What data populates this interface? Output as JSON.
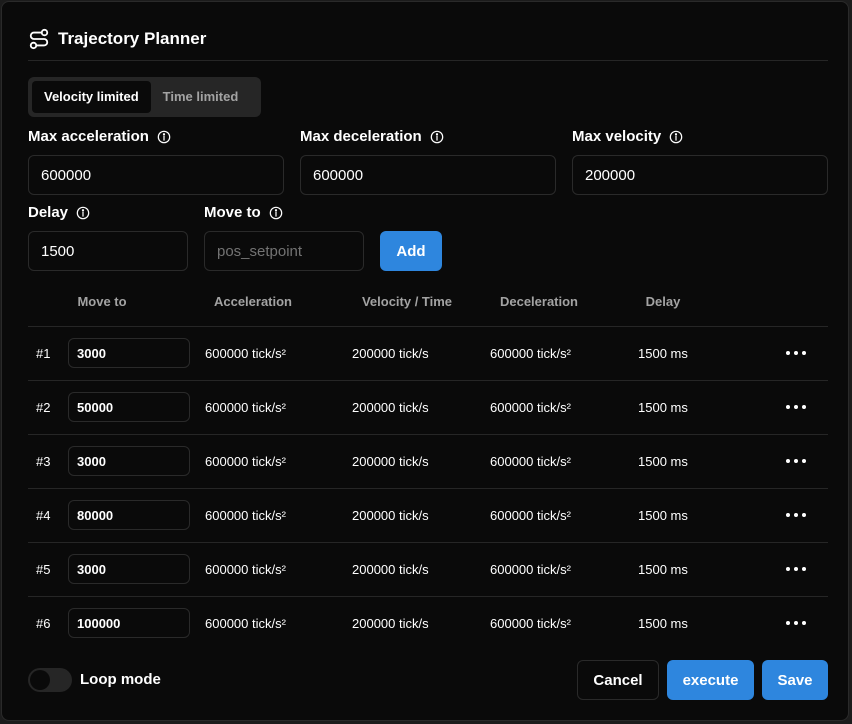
{
  "dialog": {
    "title": "Trajectory Planner",
    "icon": "route-icon"
  },
  "mode_tabs": [
    {
      "label": "Velocity limited",
      "active": true
    },
    {
      "label": "Time limited",
      "active": false
    }
  ],
  "fields": {
    "max_acceleration": {
      "label": "Max acceleration",
      "value": "600000"
    },
    "max_deceleration": {
      "label": "Max deceleration",
      "value": "600000"
    },
    "max_velocity": {
      "label": "Max velocity",
      "value": "200000"
    },
    "delay": {
      "label": "Delay",
      "value": "1500"
    },
    "move_to": {
      "label": "Move to",
      "value": "",
      "placeholder": "pos_setpoint"
    }
  },
  "add_button": "Add",
  "table": {
    "headers": [
      "Move to",
      "Acceleration",
      "Velocity / Time",
      "Deceleration",
      "Delay"
    ],
    "rows": [
      {
        "index": "#1",
        "move_to": "3000",
        "acceleration": "600000 tick/s²",
        "velocity": "200000 tick/s",
        "deceleration": "600000 tick/s²",
        "delay": "1500 ms"
      },
      {
        "index": "#2",
        "move_to": "50000",
        "acceleration": "600000 tick/s²",
        "velocity": "200000 tick/s",
        "deceleration": "600000 tick/s²",
        "delay": "1500 ms"
      },
      {
        "index": "#3",
        "move_to": "3000",
        "acceleration": "600000 tick/s²",
        "velocity": "200000 tick/s",
        "deceleration": "600000 tick/s²",
        "delay": "1500 ms"
      },
      {
        "index": "#4",
        "move_to": "80000",
        "acceleration": "600000 tick/s²",
        "velocity": "200000 tick/s",
        "deceleration": "600000 tick/s²",
        "delay": "1500 ms"
      },
      {
        "index": "#5",
        "move_to": "3000",
        "acceleration": "600000 tick/s²",
        "velocity": "200000 tick/s",
        "deceleration": "600000 tick/s²",
        "delay": "1500 ms"
      },
      {
        "index": "#6",
        "move_to": "100000",
        "acceleration": "600000 tick/s²",
        "velocity": "200000 tick/s",
        "deceleration": "600000 tick/s²",
        "delay": "1500 ms"
      }
    ]
  },
  "footer": {
    "loop_mode_label": "Loop mode",
    "loop_mode_on": false,
    "cancel_label": "Cancel",
    "execute_label": "execute",
    "save_label": "Save"
  },
  "colors": {
    "background": "#0a0a0a",
    "accent": "#2e86de",
    "border": "#2a2a2a",
    "muted_text": "#a3a3a3"
  }
}
